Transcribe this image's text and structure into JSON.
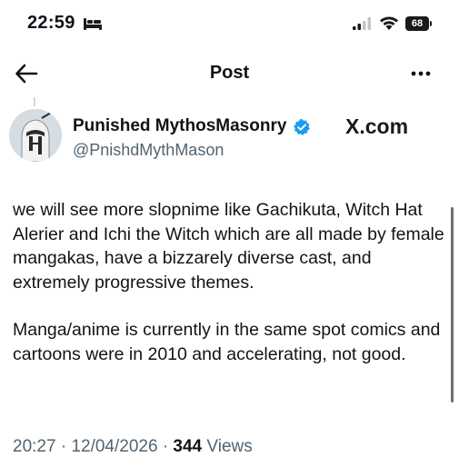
{
  "status_bar": {
    "time": "22:59",
    "battery": "68",
    "icons": [
      "bed-icon",
      "signal-icon",
      "wifi-icon",
      "battery-icon"
    ]
  },
  "header": {
    "title": "Post",
    "back_icon": "arrow-left-icon",
    "more_icon": "more-horizontal-icon"
  },
  "author": {
    "name": "Punished MythosMasonry",
    "handle": "@PnishdMythMason",
    "verified": true,
    "verified_color": "#1d9bf0"
  },
  "watermark": "X.com",
  "post": {
    "paragraphs": [
      "we will see more slopnime like Gachikuta, Witch Hat Alerier and Ichi the Witch which are all made by female mangakas, have a bizzarely diverse cast, and extremely progressive themes.",
      "Manga/anime is currently in the same spot comics and cartoons were in 2010 and accelerating, not good."
    ]
  },
  "meta": {
    "time": "20:27",
    "date": "12/04/2026",
    "views_count": "344",
    "views_label": "Views"
  },
  "colors": {
    "text": "#0f1419",
    "secondary": "#536471",
    "background": "#ffffff",
    "accent": "#1d9bf0"
  }
}
